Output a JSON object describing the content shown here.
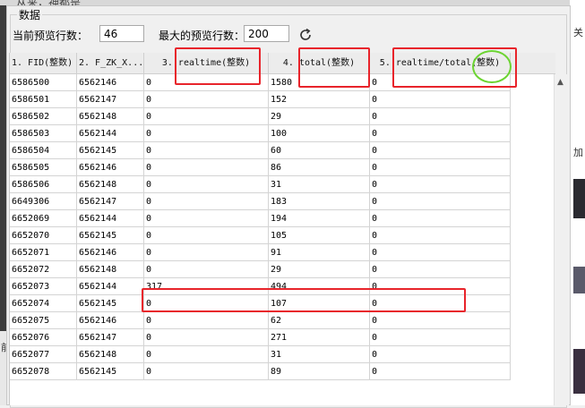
{
  "dialog": {
    "title": "数据"
  },
  "background": {
    "top_text": "从来，神都是",
    "side_glyphs": [
      "关",
      "加",
      "前"
    ]
  },
  "toolbar": {
    "current_rows_label": "当前预览行数：",
    "current_rows_value": "46",
    "max_rows_label": "最大的预览行数：",
    "max_rows_value": "200",
    "refresh_icon": "refresh-icon"
  },
  "table": {
    "columns": [
      "1. FID(整数)",
      "2. F_ZK_X...",
      "3. realtime(整数)",
      "4. total(整数)",
      "5. realtime/total(整数)"
    ],
    "rows": [
      [
        "6586500",
        "6562146",
        "0",
        "1580",
        "0"
      ],
      [
        "6586501",
        "6562147",
        "0",
        "152",
        "0"
      ],
      [
        "6586502",
        "6562148",
        "0",
        "29",
        "0"
      ],
      [
        "6586503",
        "6562144",
        "0",
        "100",
        "0"
      ],
      [
        "6586504",
        "6562145",
        "0",
        "60",
        "0"
      ],
      [
        "6586505",
        "6562146",
        "0",
        "86",
        "0"
      ],
      [
        "6586506",
        "6562148",
        "0",
        "31",
        "0"
      ],
      [
        "6649306",
        "6562147",
        "0",
        "183",
        "0"
      ],
      [
        "6652069",
        "6562144",
        "0",
        "194",
        "0"
      ],
      [
        "6652070",
        "6562145",
        "0",
        "105",
        "0"
      ],
      [
        "6652071",
        "6562146",
        "0",
        "91",
        "0"
      ],
      [
        "6652072",
        "6562148",
        "0",
        "29",
        "0"
      ],
      [
        "6652073",
        "6562144",
        "317",
        "494",
        "0"
      ],
      [
        "6652074",
        "6562145",
        "0",
        "107",
        "0"
      ],
      [
        "6652075",
        "6562146",
        "0",
        "62",
        "0"
      ],
      [
        "6652076",
        "6562147",
        "0",
        "271",
        "0"
      ],
      [
        "6652077",
        "6562148",
        "0",
        "31",
        "0"
      ],
      [
        "6652078",
        "6562145",
        "0",
        "89",
        "0"
      ]
    ]
  },
  "annotation_colors": {
    "red": "#e8242b",
    "green": "#6cd432"
  }
}
